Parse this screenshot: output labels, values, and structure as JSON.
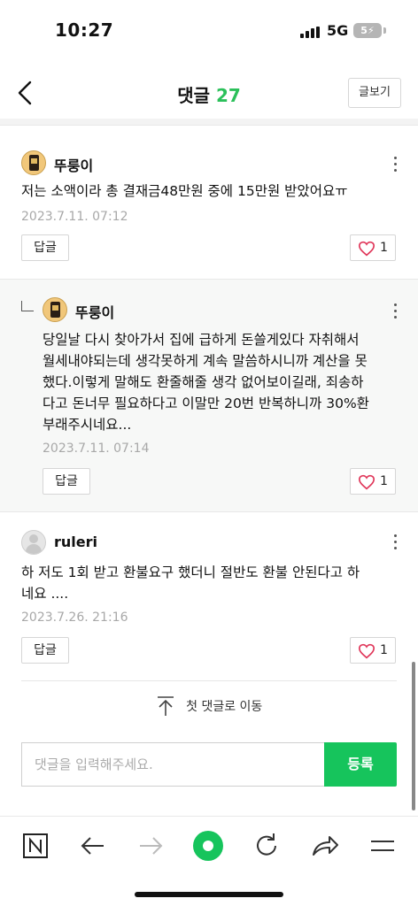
{
  "status_bar": {
    "time": "10:27",
    "network": "5G",
    "battery": "5"
  },
  "header": {
    "title": "댓글",
    "count": "27",
    "post_view_label": "글보기"
  },
  "comments": [
    {
      "nickname": "뚜룽이",
      "text": "저는 소액이라 총 결재금48만원 중에 15만원 받았어요ㅠ",
      "date": "2023.7.11. 07:12",
      "reply_label": "답글",
      "likes": "1"
    },
    {
      "nickname": "뚜룽이",
      "text": "당일날 다시 찾아가서 집에 급하게 돈쓸게있다 자취해서\n월세내야되는데 생각못하게 계속 말씀하시니까 계산을 못\n했다.이렇게 말해도 환줄해줄 생각 없어보이길래, 죄송하\n다고 돈너무 필요하다고 이말만 20번 반복하니까 30%환\n부래주시네요...",
      "date": "2023.7.11. 07:14",
      "reply_label": "답글",
      "likes": "1"
    },
    {
      "nickname": "ruleri",
      "text": "하 저도 1회 받고 환불요구 했더니 절반도 환불 안된다고 하\n네요 ....",
      "date": "2023.7.26. 21:16",
      "reply_label": "답글",
      "likes": "1"
    }
  ],
  "goto_first_label": "첫 댓글로 이동",
  "comment_input": {
    "placeholder": "댓글을 입력해주세요.",
    "value": "",
    "submit_label": "등록"
  },
  "toolbar": {
    "icons": [
      "naver-n-icon",
      "back-arrow-icon",
      "forward-arrow-icon",
      "green-dot-icon",
      "refresh-icon",
      "share-icon",
      "menu-icon"
    ],
    "accent": "#16c45c"
  },
  "colors": {
    "accent": "#16c45c",
    "count": "#2bc05a",
    "heart": "#e0375a"
  }
}
